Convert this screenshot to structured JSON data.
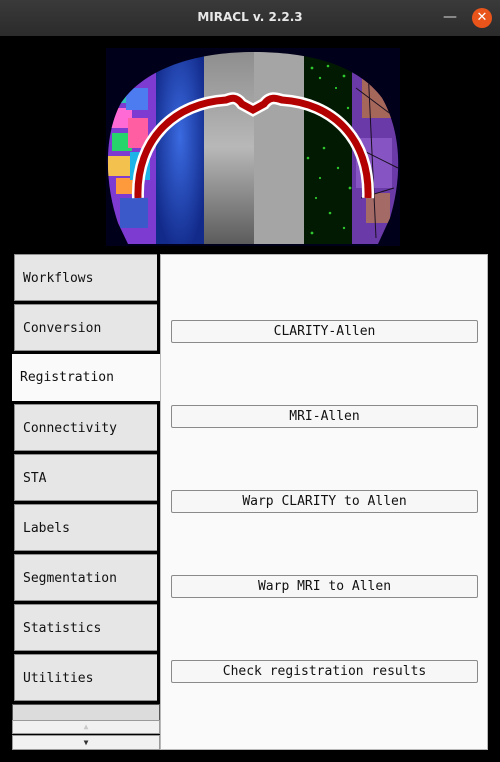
{
  "window": {
    "title": "MIRACL v. 2.2.3",
    "minimize_icon": "minimize-icon",
    "close_icon": "close-icon",
    "minimize_glyph": "—",
    "close_glyph": "✕"
  },
  "banner": {
    "description_icon": "brain-logo"
  },
  "tabs": [
    {
      "label": "Workflows",
      "active": false
    },
    {
      "label": "Conversion",
      "active": false
    },
    {
      "label": "Registration",
      "active": true
    },
    {
      "label": "Connectivity",
      "active": false
    },
    {
      "label": "STA",
      "active": false
    },
    {
      "label": "Labels",
      "active": false
    },
    {
      "label": "Segmentation",
      "active": false
    },
    {
      "label": "Statistics",
      "active": false
    },
    {
      "label": "Utilities",
      "active": false
    }
  ],
  "registration": {
    "buttons": [
      "CLARITY-Allen",
      "MRI-Allen",
      "Warp CLARITY to Allen",
      "Warp MRI to Allen",
      "Check registration results"
    ]
  },
  "scroll": {
    "up_glyph": "▲",
    "down_glyph": "▼"
  },
  "colors": {
    "close_button": "#e9541a",
    "titlebar": "#2f2f2f",
    "panel": "#fafafa",
    "tab": "#e6e6e6"
  }
}
